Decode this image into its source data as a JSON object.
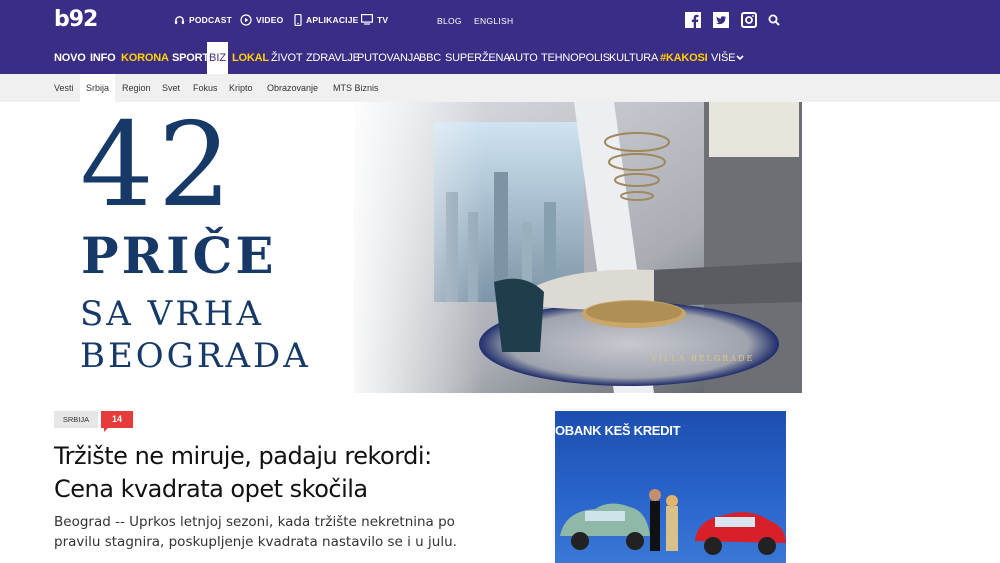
{
  "header": {
    "logo": "b92",
    "media": [
      {
        "label": "PODCAST",
        "icon": "headphones-icon"
      },
      {
        "label": "VIDEO",
        "icon": "play-icon"
      },
      {
        "label": "APLIKACIJE",
        "icon": "phone-icon"
      },
      {
        "label": "TV",
        "icon": "tv-icon"
      }
    ],
    "links": [
      "BLOG",
      "ENGLISH"
    ],
    "social": [
      "facebook-icon",
      "twitter-icon",
      "instagram-icon",
      "search-icon"
    ],
    "colors": {
      "brand": "#3a2d86",
      "highlight": "#ffd200",
      "badge": "#e53b3b"
    }
  },
  "nav": {
    "items": [
      "NOVO",
      "INFO",
      "KORONA",
      "SPORT",
      "BIZ",
      "LOKAL",
      "ŽIVOT",
      "ZDRAVLJE",
      "PUTOVANJA",
      "BBC",
      "SUPERŽENA",
      "AUTO",
      "TEHNOPOLIS",
      "KULTURA",
      "#KAKOSI",
      "VIŠE"
    ],
    "active": "BIZ"
  },
  "subnav": {
    "items": [
      "Vesti",
      "Srbija",
      "Region",
      "Svet",
      "Fokus",
      "Kripto",
      "Obrazovanje",
      "MTS Biznis"
    ],
    "active": "Srbija"
  },
  "banner": {
    "line1": "42",
    "line2": "PRIČE",
    "line3": "SA VRHA",
    "line4": "BEOGRADA",
    "brand": "VILLA BELGRADE"
  },
  "article": {
    "category": "SRBIJA",
    "comments": "14",
    "title": "Tržište ne miruje, padaju rekordi: Cena kvadrata opet skočila",
    "lead": "Beograd -- Uprkos letnjoj sezoni, kada tržište nekretnina po pravilu stagnira, poskupljenje kvadrata nastavilo se i u julu."
  },
  "sidead": {
    "title": "OBANK KEŠ KREDIT"
  }
}
